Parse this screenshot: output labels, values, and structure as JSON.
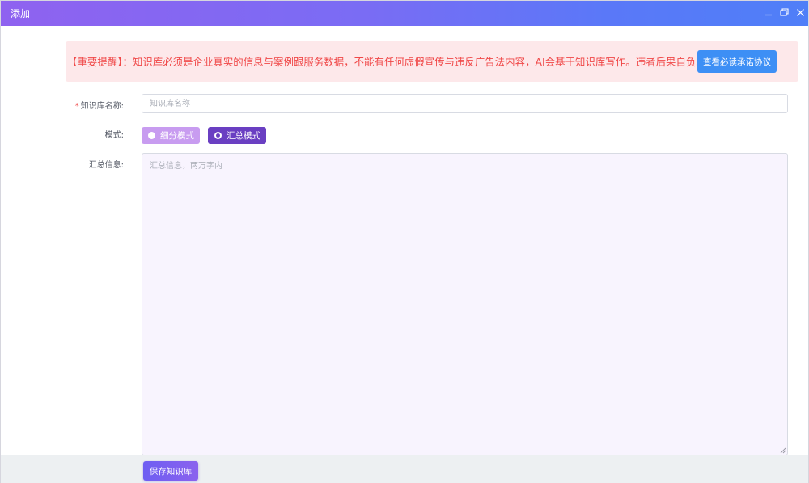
{
  "window": {
    "title": "添加",
    "controls": [
      "minimize-icon",
      "restore-icon",
      "close-icon"
    ]
  },
  "notice": {
    "text": "【重要提醒】：知识库必须是企业真实的信息与案例跟服务数据，不能有任何虚假宣传与违反广告法内容，AI会基于知识库写作。违者后果自负。",
    "button_label": "查看必读承诺协议",
    "colors": {
      "background": "#fde8ea",
      "text": "#f04848",
      "button": "#3d8ff5"
    }
  },
  "form": {
    "name": {
      "required_mark": "*",
      "label": "知识库名称:",
      "placeholder": "知识库名称",
      "value": ""
    },
    "mode": {
      "label": "模式:",
      "options": [
        {
          "label": "细分模式",
          "selected": false
        },
        {
          "label": "汇总模式",
          "selected": true
        }
      ]
    },
    "summary": {
      "label": "汇总信息:",
      "placeholder": "汇总信息，两万字内",
      "value": ""
    }
  },
  "footer": {
    "save_label": "保存知识库"
  },
  "colors": {
    "accent": "#6a3fc2",
    "accent_light": "#c89cf0",
    "titlebar_start": "#8f62f0",
    "titlebar_end": "#4f7ff8"
  }
}
